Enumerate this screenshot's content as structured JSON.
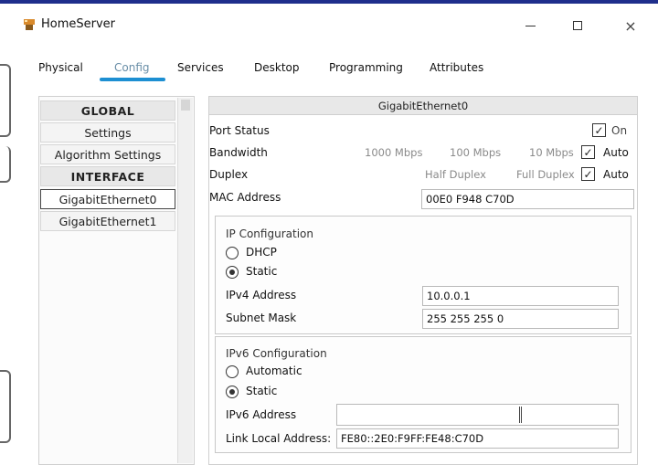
{
  "window": {
    "title": "HomeServer",
    "icon": "server-app-icon",
    "controls": {
      "minimize": "minimize-icon",
      "maximize": "maximize-icon",
      "close": "×"
    }
  },
  "tabs": [
    "Physical",
    "Config",
    "Services",
    "Desktop",
    "Programming",
    "Attributes"
  ],
  "active_tab": "Config",
  "sidebar": {
    "items": [
      {
        "label": "GLOBAL",
        "kind": "header"
      },
      {
        "label": "Settings",
        "kind": "item"
      },
      {
        "label": "Algorithm Settings",
        "kind": "item"
      },
      {
        "label": "INTERFACE",
        "kind": "header"
      },
      {
        "label": "GigabitEthernet0",
        "kind": "item",
        "selected": true
      },
      {
        "label": "GigabitEthernet1",
        "kind": "item"
      }
    ]
  },
  "panel": {
    "title": "GigabitEthernet0",
    "port_status": {
      "label": "Port Status",
      "on_label": "On",
      "on": true
    },
    "bandwidth": {
      "label": "Bandwidth",
      "options": [
        "1000 Mbps",
        "100 Mbps",
        "10 Mbps"
      ],
      "auto_label": "Auto",
      "auto": true
    },
    "duplex": {
      "label": "Duplex",
      "options": [
        "Half Duplex",
        "Full Duplex"
      ],
      "auto_label": "Auto",
      "auto": true
    },
    "mac": {
      "label": "MAC Address",
      "value": "00E0 F948 C70D"
    },
    "ipv4": {
      "title": "IP Configuration",
      "dhcp_label": "DHCP",
      "static_label": "Static",
      "mode": "Static",
      "address_label": "IPv4 Address",
      "address": "10.0.0.1",
      "mask_label": "Subnet Mask",
      "mask": "255 255 255 0"
    },
    "ipv6": {
      "title": "IPv6 Configuration",
      "automatic_label": "Automatic",
      "static_label": "Static",
      "mode": "Static",
      "address_label": "IPv6 Address",
      "address": "",
      "link_local_label": "Link Local Address:",
      "link_local": "FE80::2E0:F9FF:FE48:C70D"
    }
  }
}
